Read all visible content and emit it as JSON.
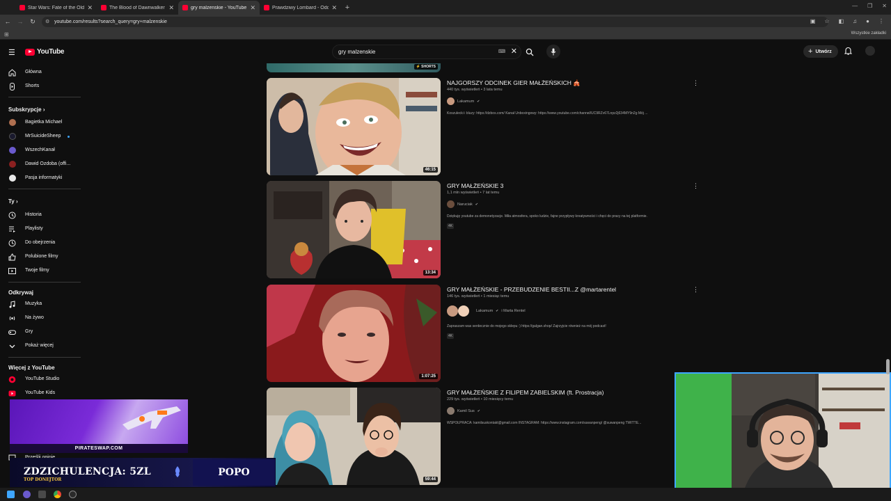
{
  "browser": {
    "tabs": [
      {
        "title": "Star Wars: Fate of the Old Repu",
        "active": false
      },
      {
        "title": "The Blood of Dawnwalker — P",
        "active": false
      },
      {
        "title": "gry malzenskie - YouTube",
        "active": true
      },
      {
        "title": "Prawdziwy Lombard - Odcinek",
        "active": false
      }
    ],
    "url": "youtube.com/results?search_query=gry+malzenskie",
    "bookmarks_all": "Wszystkie zakładki"
  },
  "header": {
    "logo_text": "YouTube",
    "search_value": "gry malzenskie",
    "create_label": "Utwórz",
    "accent_color": "#ff0033"
  },
  "sidebar": {
    "main": [
      {
        "label": "Główna",
        "icon": "home-icon"
      },
      {
        "label": "Shorts",
        "icon": "shorts-icon"
      }
    ],
    "subscriptions_title": "Subskrypcje",
    "subscriptions": [
      {
        "label": "Bagietka Michael",
        "color": "#b07050",
        "live": false
      },
      {
        "label": "MrSuicideSheep",
        "color": "#1a1a2e",
        "live": true
      },
      {
        "label": "WszechKanał",
        "color": "#6a5acd",
        "live": false
      },
      {
        "label": "Dawid Ozdoba (offi...",
        "color": "#8b2020",
        "live": false
      },
      {
        "label": "Pasja informatyki",
        "color": "#e8e8e8",
        "live": false
      }
    ],
    "you_title": "Ty",
    "you": [
      {
        "label": "Historia",
        "icon": "history-icon"
      },
      {
        "label": "Playlisty",
        "icon": "playlist-icon"
      },
      {
        "label": "Do obejrzenia",
        "icon": "watch-later-icon"
      },
      {
        "label": "Polubione filmy",
        "icon": "like-icon"
      },
      {
        "label": "Twoje filmy",
        "icon": "your-videos-icon"
      }
    ],
    "explore_title": "Odkrywaj",
    "explore": [
      {
        "label": "Muzyka",
        "icon": "music-icon"
      },
      {
        "label": "Na żywo",
        "icon": "live-icon"
      },
      {
        "label": "Gry",
        "icon": "gaming-icon"
      },
      {
        "label": "Pokaż więcej",
        "icon": "chevron-down-icon"
      }
    ],
    "more_title": "Więcej z YouTube",
    "more": [
      {
        "label": "YouTube Studio",
        "icon": "studio-icon"
      },
      {
        "label": "YouTube Kids",
        "icon": "kids-icon"
      }
    ],
    "feedback": "Prześlij opinię"
  },
  "results": {
    "shorts_badge": "SHORTS",
    "items": [
      {
        "title": "NAJGORSZY ODCINEK GIER MAŁŻEŃSKICH 🎪",
        "meta": "440 tys. wyświetleń • 3 lata temu",
        "channel": "Lakamum",
        "description": "Koszulecki i bluzy: https://dzbos.com/ Kanał Unboxingowy: https://www.youtube.com/channel/UC9RZv67Lnpz2j634MY9n2g Mój ...",
        "badge": "",
        "duration": "46:15"
      },
      {
        "title": "GRY MAŁŻEŃSKIE 3",
        "meta": "1,1 mln wyświetleń • 7 lat temu",
        "channel": "Naruciak",
        "description": "Dziękuję youtube za demonetyzacje. Miła atmosfera, spoko ludzie, fajne przypływy kreatywności i chęci do pracy na tej platformie.",
        "badge": "4K",
        "duration": "13:34"
      },
      {
        "title": "GRY MAŁŻEŃSKIE - PRZEBUDZENIE BESTII...Z @martarentel",
        "meta": "146 tys. wyświetleń • 1 miesiąc temu",
        "channel": "Lakamum",
        "channel2": "i Marta Rentel",
        "description": "Zapraszam was serdecznie do mojego sklepu :) https://galgan.shop/ Zajrzyjcie również na mój podcast!",
        "badge": "4K",
        "duration": "1:07:25"
      },
      {
        "title": "GRY MAŁŻEŃSKIE Z FILIPEM ZABIELSKIM (ft. Prostracja)",
        "meta": "229 tys. wyświetleń • 10 miesięcy temu",
        "channel": "Kamil Sus",
        "description": "WSPÓŁPRACA: kamilsuskontakt@gmail.com INSTAGRAM: https://www.instagram.com/suwanpeng/ @suwanpeng TWITTE...",
        "badge": "",
        "duration": "59:44"
      }
    ]
  },
  "overlays": {
    "promo_url": "PIRATESWAP.COM",
    "donor_name": "ZDZICHULENCJA: 5ZL",
    "donor_label": "TOP DONEJTOR",
    "donor_box": "POPO"
  }
}
